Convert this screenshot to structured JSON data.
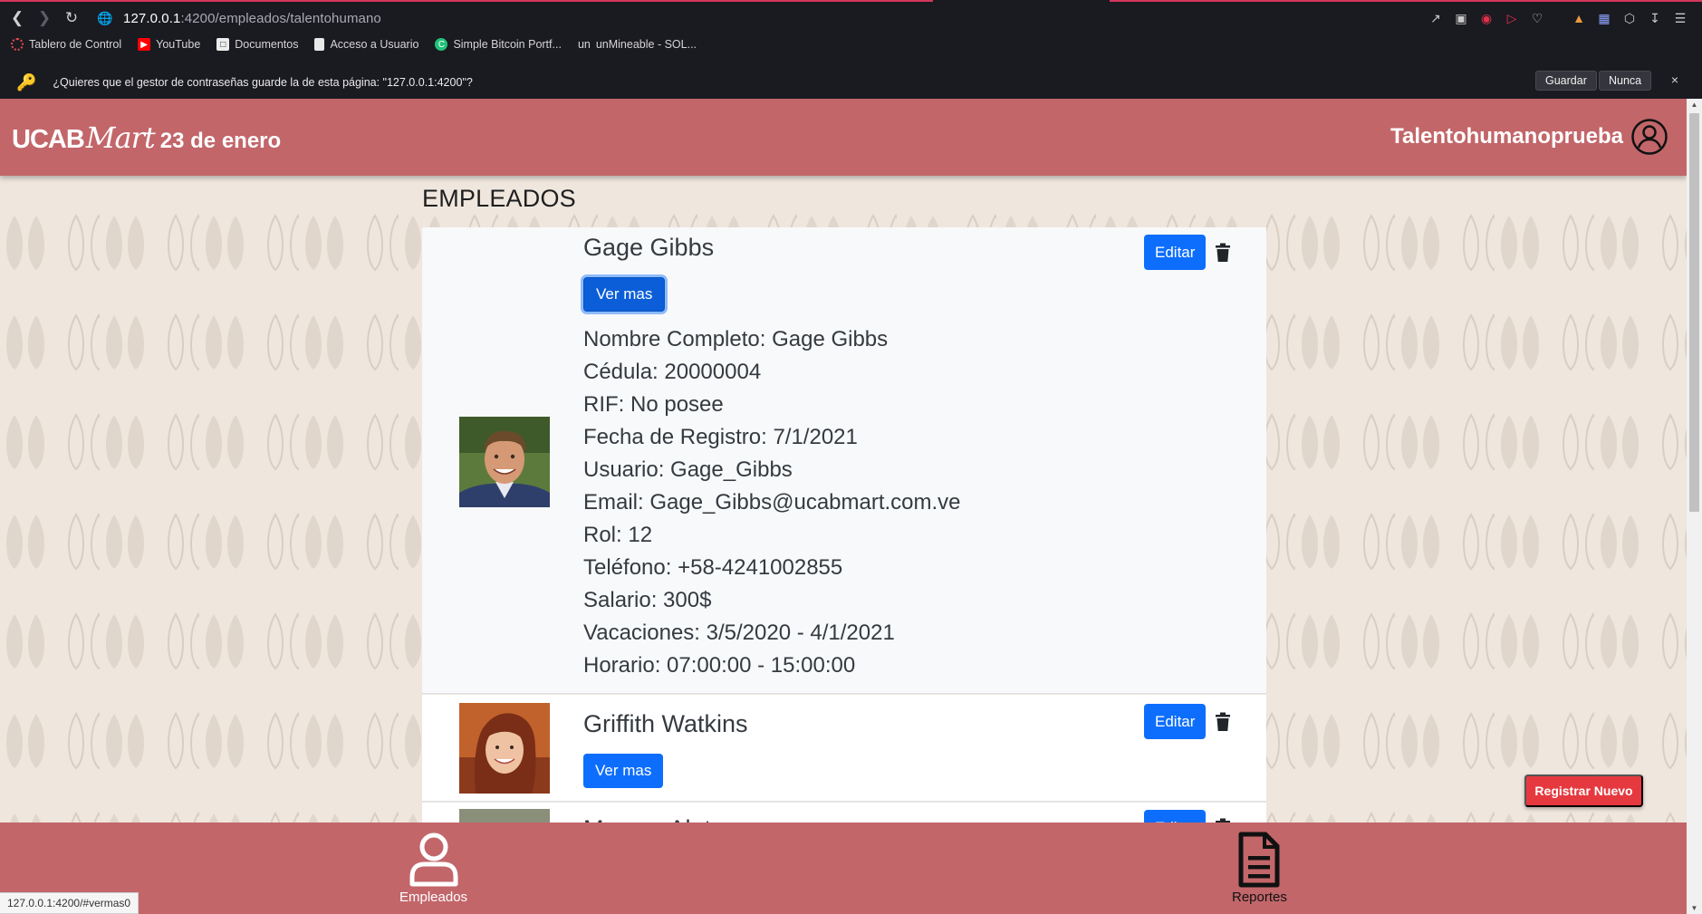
{
  "browser": {
    "url_host": "127.0.0.1",
    "url_path": ":4200/empleados/talentohumano",
    "bookmarks": [
      {
        "label": "Tablero de Control",
        "icon": "chromium-icon"
      },
      {
        "label": "YouTube",
        "icon": "youtube-icon"
      },
      {
        "label": "Documentos",
        "icon": "document-icon"
      },
      {
        "label": "Acceso a Usuario",
        "icon": "file-icon"
      },
      {
        "label": "Simple Bitcoin Portf...",
        "icon": "coin-icon"
      },
      {
        "label": "un",
        "icon": "text-icon"
      },
      {
        "label": "unMineable - SOL...",
        "icon": "none"
      }
    ],
    "password_prompt": {
      "text": "¿Quieres que el gestor de contraseñas guarde la de esta página: \"127.0.0.1:4200\"?",
      "save_label": "Guardar",
      "never_label": "Nunca",
      "close": "×"
    },
    "status_url": "127.0.0.1:4200/#vermas0"
  },
  "header": {
    "brand_ucab": "UCAB",
    "brand_mart": "Mart",
    "date": "23 de enero",
    "username": "Talentohumanoprueba"
  },
  "page": {
    "title": "EMPLEADOS"
  },
  "employees": [
    {
      "name": "Gage Gibbs",
      "view_label": "Ver mas",
      "edit_label": "Editar",
      "details": [
        "Nombre Completo: Gage Gibbs",
        "Cédula: 20000004",
        "RIF: No posee",
        "Fecha de Registro: 7/1/2021",
        "Usuario: Gage_Gibbs",
        "Email: Gage_Gibbs@ucabmart.com.ve",
        "Rol: 12",
        "Teléfono: +58-4241002855",
        "Salario: 300$",
        "Vacaciones: 3/5/2020 - 4/1/2021",
        "Horario: 07:00:00 - 15:00:00"
      ]
    },
    {
      "name": "Griffith Watkins",
      "view_label": "Ver mas",
      "edit_label": "Editar"
    },
    {
      "name": "Marcus Alato",
      "edit_label": "Editar"
    }
  ],
  "actions": {
    "register_new": "Registrar Nuevo"
  },
  "bottom_nav": [
    {
      "label": "Empleados",
      "icon": "person-icon"
    },
    {
      "label": "Reportes",
      "icon": "document-icon"
    }
  ],
  "colors": {
    "header_bg": "#c2666a",
    "primary": "#0d6efd",
    "danger": "#e5393f",
    "page_bg": "#efe6dd"
  }
}
